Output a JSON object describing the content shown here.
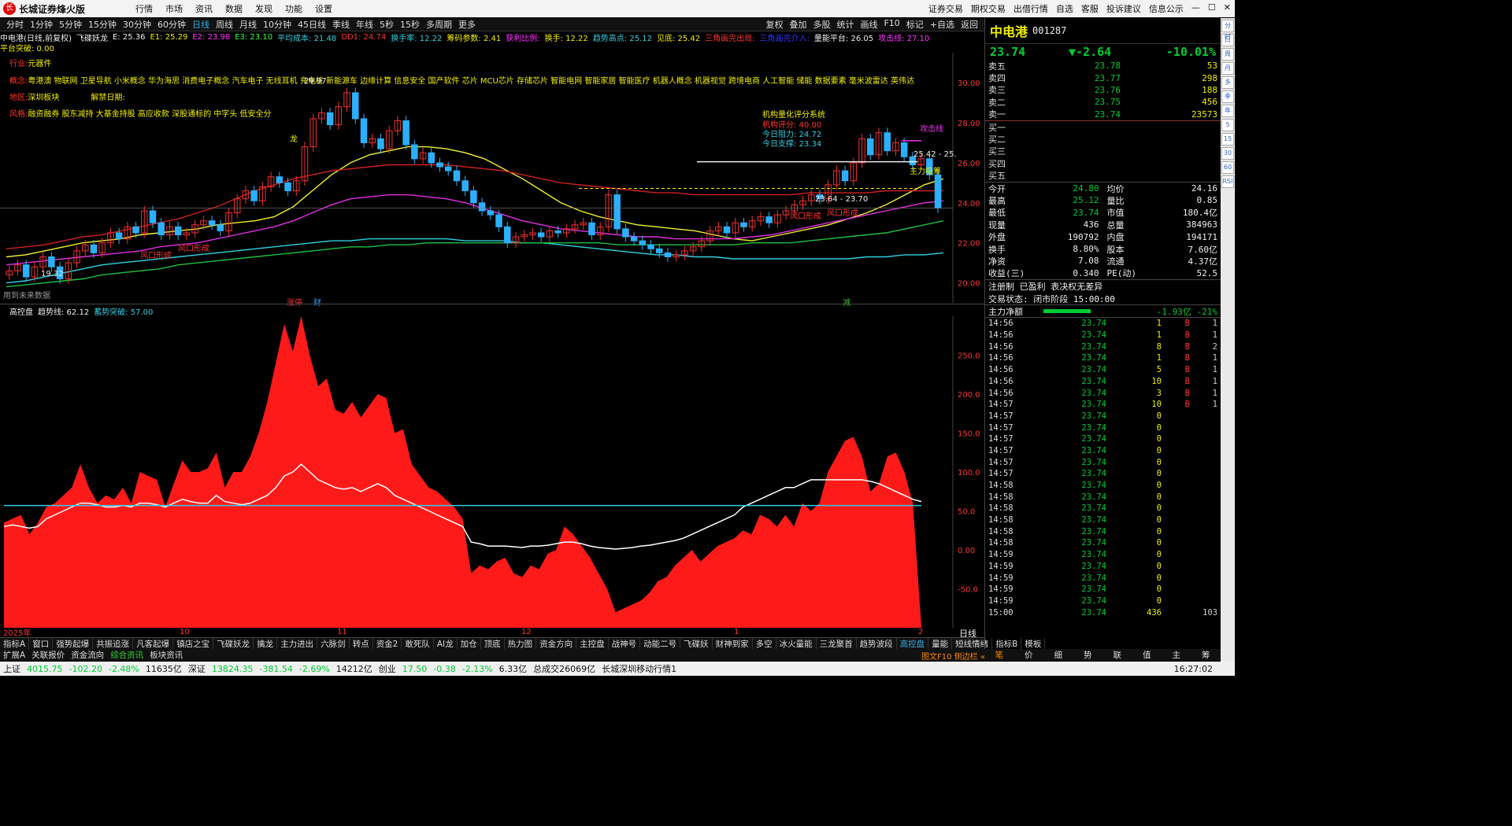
{
  "titlebar": {
    "app": "长城证券烽火版",
    "menus": [
      "行情",
      "市场",
      "资讯",
      "数据",
      "发现",
      "功能",
      "设置"
    ],
    "right": [
      "证券交易",
      "期权交易",
      "出借行情",
      "自选",
      "客服",
      "投诉建议",
      "信息公示"
    ]
  },
  "periods": {
    "items": [
      "分时",
      "1分钟",
      "5分钟",
      "15分钟",
      "30分钟",
      "60分钟",
      "日线",
      "周线",
      "月线",
      "10分钟",
      "45日线",
      "季线",
      "年线",
      "5秒",
      "15秒",
      "多周期",
      "更多"
    ],
    "active": "日线",
    "right": [
      "复权",
      "叠加",
      "多股",
      "统计",
      "画线",
      "F10",
      "标记",
      "+自选",
      "返回"
    ]
  },
  "kline_header": {
    "stock": "中电港(日线,前复权)",
    "items": [
      {
        "t": "飞碟妖龙",
        "c": "#eee"
      },
      {
        "t": "E: 25.36",
        "c": "#eee"
      },
      {
        "t": "E1: 25.29",
        "c": "#ee0"
      },
      {
        "t": "E2: 23.98",
        "c": "#f3f"
      },
      {
        "t": "E3: 23.10",
        "c": "#3f3"
      },
      {
        "t": "平均成本: 21.48",
        "c": "#3cd"
      },
      {
        "t": "DD1: 24.74",
        "c": "#f33"
      },
      {
        "t": "换手率: 12.22",
        "c": "#3cd"
      },
      {
        "t": "筹码参数: 2.41",
        "c": "#ee0"
      },
      {
        "t": "获利比例:",
        "c": "#f3f"
      },
      {
        "t": "换手: 12.22",
        "c": "#ee0"
      },
      {
        "t": "趋势高点: 25.12",
        "c": "#3cd"
      },
      {
        "t": "见底: 25.42",
        "c": "#ee0"
      },
      {
        "t": "三角画完出局:",
        "c": "#f33"
      },
      {
        "t": "三角画完介入:",
        "c": "#33f"
      },
      {
        "t": "量能平台: 26.05",
        "c": "#eee"
      },
      {
        "t": "攻击线: 27.10",
        "c": "#f3f"
      }
    ],
    "line2": "平台突破: 0.00"
  },
  "info": {
    "industry_label": "行业:",
    "industry": "元器件",
    "concept_label": "概念:",
    "concept": "粤港澳 物联网 卫星导航 小米概念 华为海思 消费电子概念 汽车电子 无线耳机 充电桩 新能源车 边缘计算 信息安全 国产软件 芯片 MCU芯片 存储芯片 智能电网 智能家居 智能医疗 机器人概念 机器视觉 跨境电商 人工智能 储能 数据要素 毫米波雷达 英伟达",
    "region_label": "地区:",
    "region": "深圳板块",
    "unlock_label": "解禁日期:",
    "style_label": "风格:",
    "style": "融资融券 股东减持 大基金持股 高应收款 深股通标的 中字头 低安全分"
  },
  "rating": {
    "title": "机构量化评分系统",
    "score": "机构评分: 40.00",
    "resist": "今日阻力: 24.72",
    "support": "今日支撑: 23.34"
  },
  "annotations": {
    "attack_line": "攻击线",
    "main_buy": "主力吸筹",
    "price_range": "23.64 - 23.70",
    "right_price": "25.42 - 25.",
    "low_mark": "19.32",
    "high_mark": "29.97",
    "future": "用到未来数据",
    "zhangting": "涨停",
    "cai": "财",
    "jian": "减",
    "fengkou": "风口形成",
    "dragon": "龙"
  },
  "kchart": {
    "y_ticks": [
      "30.00",
      "28.00",
      "26.00",
      "24.00",
      "22.00",
      "20.00"
    ],
    "ymin": 19.0,
    "ymax": 31.5,
    "close": [
      20.6,
      20.9,
      20.3,
      20.8,
      21.3,
      20.8,
      20.2,
      21.0,
      21.6,
      21.9,
      21.5,
      22.0,
      22.5,
      22.2,
      22.8,
      22.5,
      23.6,
      23.0,
      22.4,
      22.8,
      22.4,
      22.5,
      22.9,
      23.1,
      22.9,
      22.6,
      23.5,
      24.2,
      24.6,
      24.1,
      24.8,
      25.3,
      25.0,
      24.6,
      25.1,
      26.8,
      28.2,
      28.5,
      27.9,
      28.8,
      29.5,
      28.2,
      27.0,
      27.2,
      26.7,
      27.6,
      28.1,
      26.9,
      26.2,
      26.5,
      26.0,
      25.8,
      25.6,
      25.1,
      24.6,
      24.0,
      23.6,
      23.4,
      22.8,
      22.0,
      22.3,
      22.4,
      22.5,
      22.3,
      22.6,
      22.5,
      22.7,
      22.9,
      23.0,
      22.4,
      22.8,
      24.4,
      22.7,
      22.3,
      22.1,
      21.9,
      21.7,
      21.5,
      21.3,
      21.4,
      21.6,
      21.8,
      22.1,
      22.6,
      22.8,
      22.5,
      23.0,
      22.8,
      23.1,
      23.3,
      23.0,
      23.4,
      23.6,
      23.9,
      24.1,
      24.4,
      24.2,
      24.9,
      25.6,
      25.1,
      26.0,
      27.2,
      26.4,
      27.5,
      26.6,
      27.0,
      26.3,
      25.9,
      26.2,
      25.4,
      23.74
    ],
    "ma": [
      {
        "name": "E1",
        "color": "#f0f033",
        "v": [
          21.3,
          21.4,
          21.6,
          21.8,
          22.0,
          22.1,
          22.2,
          22.4,
          22.5,
          22.6,
          22.7,
          22.9,
          23.0,
          23.1,
          23.3,
          23.8,
          24.6,
          25.4,
          26.0,
          26.4,
          26.6,
          26.8,
          26.8,
          26.7,
          26.5,
          26.2,
          25.7,
          25.2,
          24.6,
          24.0,
          23.6,
          23.3,
          23.1,
          22.9,
          22.8,
          22.7,
          22.6,
          22.4,
          22.2,
          22.1,
          22.3,
          22.5,
          22.7,
          22.9,
          23.2,
          23.5,
          23.9,
          24.4,
          24.9,
          25.2
        ]
      },
      {
        "name": "E2",
        "color": "#e030e0",
        "v": [
          20.9,
          21.0,
          21.1,
          21.2,
          21.3,
          21.4,
          21.5,
          21.6,
          21.8,
          21.9,
          22.0,
          22.2,
          22.4,
          22.6,
          22.8,
          23.1,
          23.5,
          23.9,
          24.2,
          24.3,
          24.4,
          24.4,
          24.3,
          24.2,
          24.0,
          23.7,
          23.4,
          23.1,
          22.9,
          22.7,
          22.6,
          22.5,
          22.4,
          22.3,
          22.3,
          22.2,
          22.2,
          22.2,
          22.2,
          22.3,
          22.4,
          22.6,
          22.8,
          23.0,
          23.2,
          23.4,
          23.6,
          23.8,
          24.0,
          24.1
        ]
      },
      {
        "name": "E3",
        "color": "#d02020",
        "v": [
          21.7,
          21.8,
          21.9,
          22.1,
          22.3,
          22.4,
          22.6,
          22.8,
          23.0,
          23.2,
          23.5,
          23.8,
          24.2,
          24.6,
          24.9,
          25.2,
          25.4,
          25.6,
          25.7,
          25.8,
          25.9,
          25.9,
          25.9,
          25.9,
          25.8,
          25.7,
          25.6,
          25.4,
          25.2,
          25.0,
          24.9,
          24.8,
          24.7,
          24.6,
          24.5,
          24.5,
          24.4,
          24.4,
          24.4,
          24.4,
          24.4,
          24.4,
          24.5,
          24.5,
          24.5,
          24.5,
          24.6,
          24.6,
          24.6,
          24.6
        ]
      },
      {
        "name": "cost",
        "color": "#30d0e0",
        "v": [
          20.0,
          20.1,
          20.3,
          20.5,
          20.7,
          20.9,
          21.0,
          21.1,
          21.2,
          21.3,
          21.4,
          21.5,
          21.6,
          21.7,
          21.8,
          21.9,
          22.0,
          22.1,
          22.1,
          22.2,
          22.2,
          22.2,
          22.2,
          22.2,
          22.1,
          22.1,
          22.1,
          22.0,
          22.0,
          21.9,
          21.8,
          21.7,
          21.6,
          21.5,
          21.4,
          21.4,
          21.3,
          21.3,
          21.2,
          21.2,
          21.2,
          21.2,
          21.2,
          21.2,
          21.2,
          21.3,
          21.3,
          21.4,
          21.4,
          21.5
        ]
      },
      {
        "name": "green",
        "color": "#20c040",
        "v": [
          19.8,
          19.9,
          20.0,
          20.1,
          20.2,
          20.4,
          20.5,
          20.6,
          20.7,
          20.9,
          21.0,
          21.1,
          21.2,
          21.3,
          21.4,
          21.5,
          21.6,
          21.7,
          21.8,
          21.8,
          21.9,
          21.9,
          22.0,
          22.0,
          22.0,
          22.0,
          22.0,
          22.0,
          22.0,
          22.0,
          22.0,
          22.0,
          21.9,
          21.9,
          21.9,
          21.9,
          21.9,
          21.9,
          21.9,
          22.0,
          22.0,
          22.0,
          22.1,
          22.2,
          22.3,
          22.4,
          22.5,
          22.7,
          22.9,
          23.1
        ]
      }
    ]
  },
  "subchart": {
    "header": [
      {
        "t": "高控盘",
        "c": "#eee"
      },
      {
        "t": "趋势线: 62.12",
        "c": "#eee"
      },
      {
        "t": "蓄势突破: 57.00",
        "c": "#3cd"
      }
    ],
    "y_ticks": [
      "250.0",
      "200.0",
      "150.0",
      "100.0",
      "50.0",
      "0.00",
      "-50.0"
    ],
    "ymin": -100,
    "ymax": 300,
    "baseline": 57,
    "values": [
      35,
      40,
      45,
      20,
      35,
      55,
      60,
      70,
      80,
      110,
      80,
      60,
      70,
      65,
      80,
      60,
      100,
      95,
      90,
      55,
      85,
      115,
      100,
      100,
      105,
      125,
      80,
      100,
      100,
      120,
      150,
      190,
      240,
      290,
      255,
      300,
      250,
      210,
      220,
      180,
      175,
      190,
      170,
      185,
      200,
      195,
      150,
      155,
      110,
      95,
      80,
      75,
      65,
      55,
      40,
      -30,
      -20,
      -25,
      -15,
      -10,
      -30,
      -35,
      -20,
      -25,
      -5,
      0,
      30,
      20,
      5,
      -10,
      -30,
      -50,
      -80,
      -75,
      -70,
      -65,
      -55,
      -40,
      -35,
      -20,
      -10,
      0,
      -15,
      -5,
      5,
      10,
      15,
      25,
      20,
      45,
      40,
      30,
      45,
      30,
      60,
      50,
      60,
      100,
      120,
      140,
      145,
      120,
      75,
      85,
      120,
      125,
      100,
      60,
      -100
    ],
    "trend": [
      30,
      32,
      30,
      28,
      30,
      40,
      45,
      50,
      55,
      60,
      60,
      58,
      55,
      55,
      57,
      55,
      60,
      60,
      58,
      55,
      60,
      65,
      62,
      60,
      60,
      70,
      62,
      60,
      58,
      60,
      65,
      70,
      80,
      95,
      100,
      110,
      100,
      90,
      85,
      80,
      78,
      80,
      75,
      80,
      85,
      80,
      70,
      65,
      60,
      55,
      50,
      45,
      40,
      35,
      30,
      10,
      8,
      5,
      5,
      5,
      4,
      3,
      5,
      5,
      6,
      8,
      10,
      10,
      8,
      5,
      3,
      2,
      1,
      2,
      3,
      5,
      6,
      8,
      10,
      12,
      15,
      20,
      25,
      30,
      35,
      40,
      45,
      55,
      60,
      65,
      70,
      75,
      80,
      80,
      85,
      90,
      90,
      90,
      90,
      90,
      90,
      90,
      88,
      85,
      80,
      75,
      70,
      65,
      62
    ]
  },
  "panel": {
    "name": "中电港",
    "code": "001287",
    "price": "23.74",
    "change": "▼-2.64",
    "pct": "-10.01%",
    "asks": [
      [
        "卖五",
        "23.78",
        "53"
      ],
      [
        "卖四",
        "23.77",
        "298"
      ],
      [
        "卖三",
        "23.76",
        "188"
      ],
      [
        "卖二",
        "23.75",
        "456"
      ],
      [
        "卖一",
        "23.74",
        "23573"
      ]
    ],
    "bids": [
      "买一",
      "买二",
      "买三",
      "买四",
      "买五"
    ],
    "stats": [
      [
        "今开",
        "24.80",
        "均价",
        "24.16"
      ],
      [
        "最高",
        "25.12",
        "量比",
        "0.85"
      ],
      [
        "最低",
        "23.74",
        "市值",
        "180.4亿"
      ],
      [
        "现量",
        "436",
        "总量",
        "384963"
      ],
      [
        "外盘",
        "190792",
        "内盘",
        "194171"
      ],
      [
        "换手",
        "8.80%",
        "股本",
        "7.60亿"
      ],
      [
        "净资",
        "7.08",
        "流通",
        "4.37亿"
      ],
      [
        "收益(三)",
        "0.340",
        "PE(动)",
        "52.5"
      ]
    ],
    "tags": "注册制  已盈利  表决权无差异",
    "trade_status": "交易状态: 闭市阶段 15:00:00",
    "flow_label": "主力净额",
    "flow_value": "-1.93亿 -21%",
    "ticks": [
      [
        "14:56",
        "23.74",
        "1",
        "B",
        "1"
      ],
      [
        "14:56",
        "23.74",
        "1",
        "B",
        "1"
      ],
      [
        "14:56",
        "23.74",
        "8",
        "B",
        "2"
      ],
      [
        "14:56",
        "23.74",
        "1",
        "B",
        "1"
      ],
      [
        "14:56",
        "23.74",
        "5",
        "B",
        "1"
      ],
      [
        "14:56",
        "23.74",
        "10",
        "B",
        "1"
      ],
      [
        "14:56",
        "23.74",
        "3",
        "B",
        "1"
      ],
      [
        "14:57",
        "23.74",
        "10",
        "B",
        "1"
      ],
      [
        "14:57",
        "23.74",
        "0",
        "",
        ""
      ],
      [
        "14:57",
        "23.74",
        "0",
        "",
        ""
      ],
      [
        "14:57",
        "23.74",
        "0",
        "",
        ""
      ],
      [
        "14:57",
        "23.74",
        "0",
        "",
        ""
      ],
      [
        "14:57",
        "23.74",
        "0",
        "",
        ""
      ],
      [
        "14:57",
        "23.74",
        "0",
        "",
        ""
      ],
      [
        "14:58",
        "23.74",
        "0",
        "",
        ""
      ],
      [
        "14:58",
        "23.74",
        "0",
        "",
        ""
      ],
      [
        "14:58",
        "23.74",
        "0",
        "",
        ""
      ],
      [
        "14:58",
        "23.74",
        "0",
        "",
        ""
      ],
      [
        "14:58",
        "23.74",
        "0",
        "",
        ""
      ],
      [
        "14:58",
        "23.74",
        "0",
        "",
        ""
      ],
      [
        "14:59",
        "23.74",
        "0",
        "",
        ""
      ],
      [
        "14:59",
        "23.74",
        "0",
        "",
        ""
      ],
      [
        "14:59",
        "23.74",
        "0",
        "",
        ""
      ],
      [
        "14:59",
        "23.74",
        "0",
        "",
        ""
      ],
      [
        "14:59",
        "23.74",
        "0",
        "",
        ""
      ],
      [
        "15:00",
        "23.74",
        "436",
        "",
        "103"
      ]
    ]
  },
  "xaxis": [
    "2025年",
    "10",
    "11",
    "12",
    "1",
    "2"
  ],
  "sidebar": [
    "分时",
    "日",
    "周",
    "月",
    "多",
    "季",
    "年",
    "5",
    "15",
    "30",
    "60",
    "RSI"
  ],
  "tabs1": {
    "items": [
      "指标A",
      "窗口",
      "强势起爆",
      "共振追涨",
      "凡客起爆",
      "镇店之宝",
      "飞碟妖龙",
      "擒龙",
      "主力进出",
      "六脉剑",
      "转点",
      "资金2",
      "敢死队",
      "AI龙",
      "加仓",
      "顶底",
      "热力图",
      "资金方向",
      "主控盘",
      "战神号",
      "动能二号",
      "飞碟妖",
      "财神到家",
      "多空",
      "冰火量能",
      "三龙聚首",
      "趋势波段",
      "高控盘",
      "量能",
      "短线情绪"
    ],
    "active": "高控盘",
    "right": [
      "指标B",
      "模板"
    ]
  },
  "tabs2": {
    "items": [
      "扩展A",
      "关联报价",
      "资金流向",
      "综合资讯",
      "板块资讯"
    ],
    "active": "综合资讯"
  },
  "ptabs": {
    "items": [
      "笔",
      "价",
      "细",
      "势",
      "联",
      "值",
      "主",
      "筹"
    ],
    "active": "笔"
  },
  "status": {
    "sh_label": "上证",
    "sh": "4015.75",
    "sh_chg": "-102.20",
    "sh_pct": "-2.48%",
    "sh_amt": "11635亿",
    "sz_label": "深证",
    "sz": "13824.35",
    "sz_chg": "-381.54",
    "sz_pct": "-2.69%",
    "sz_amt": "14212亿",
    "cy_label": "创业",
    "cy": "17.50",
    "cy_chg": "-0.38",
    "cy_pct": "-2.13%",
    "cy_amt": "6.33亿",
    "total": "总成交26069亿",
    "mobile": "长城深圳移动行情1",
    "time": "16:27:02"
  },
  "rlabel": "图文F10 侧边栏 «",
  "period_label": "日线"
}
